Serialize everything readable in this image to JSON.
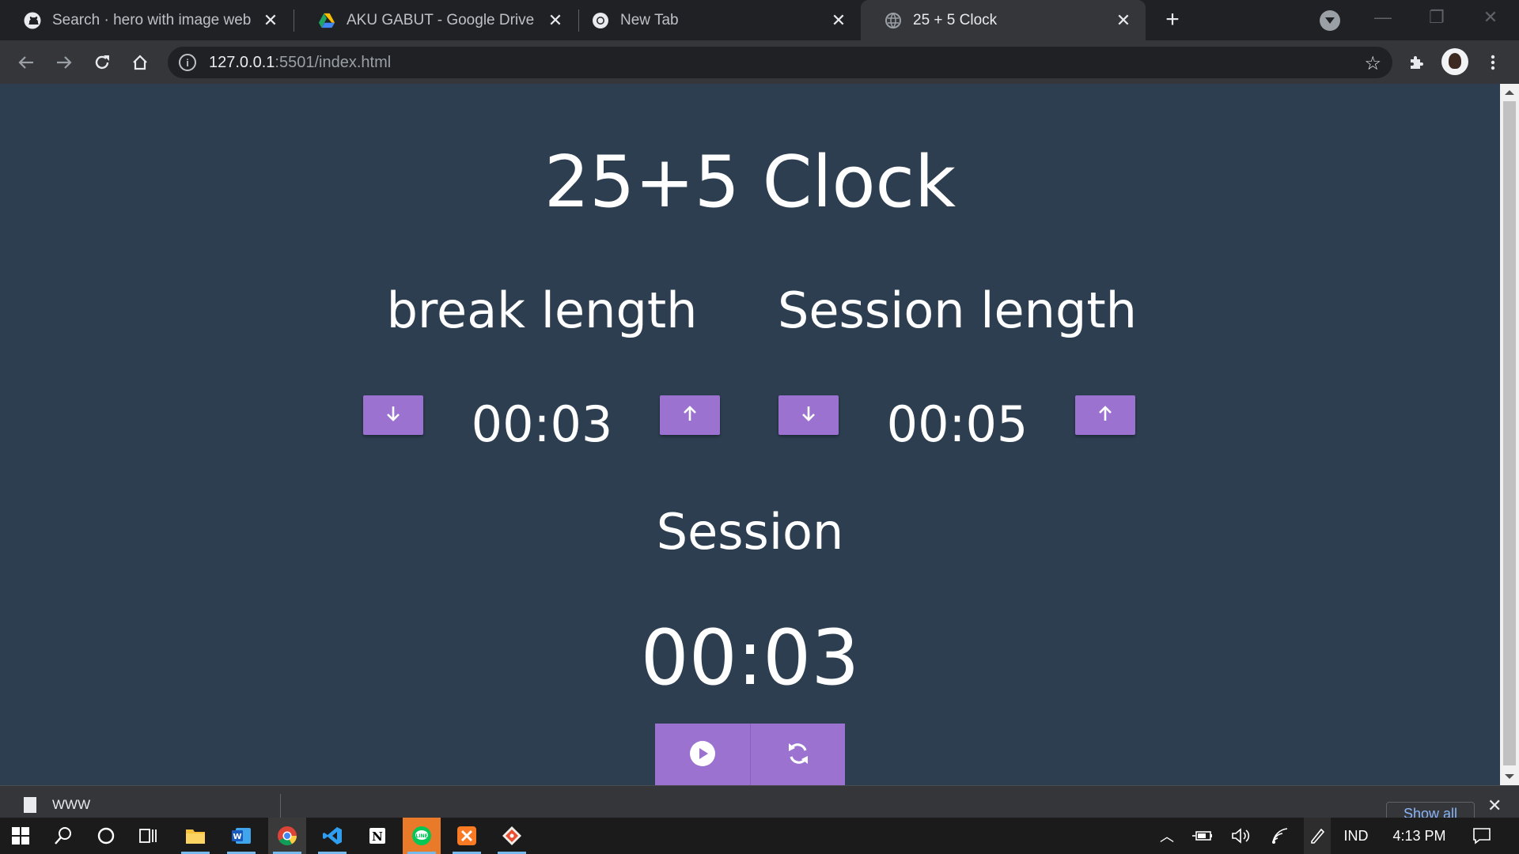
{
  "browser": {
    "tabs": [
      {
        "title": "Search · hero with image web",
        "icon": "github-icon",
        "active": false
      },
      {
        "title": "AKU GABUT - Google Drive",
        "icon": "google-drive-icon",
        "active": false
      },
      {
        "title": "New Tab",
        "icon": "chrome-icon",
        "active": false
      },
      {
        "title": "25 + 5 Clock",
        "icon": "globe-icon",
        "active": true
      }
    ],
    "url_host": "127.0.0.1",
    "url_path": ":5501/index.html"
  },
  "app": {
    "title": "25+5 Clock",
    "break_label": "break length",
    "session_length_label": "Session length",
    "break_length": "00:03",
    "session_length": "00:05",
    "timer_label": "Session",
    "time_left": "00:03",
    "accent_color": "#9b72cf",
    "background_color": "#2c3e50"
  },
  "downloads": {
    "item_name": "WWW",
    "show_all_label": "Show all"
  },
  "taskbar": {
    "language": "IND",
    "time": "4:13 PM"
  }
}
